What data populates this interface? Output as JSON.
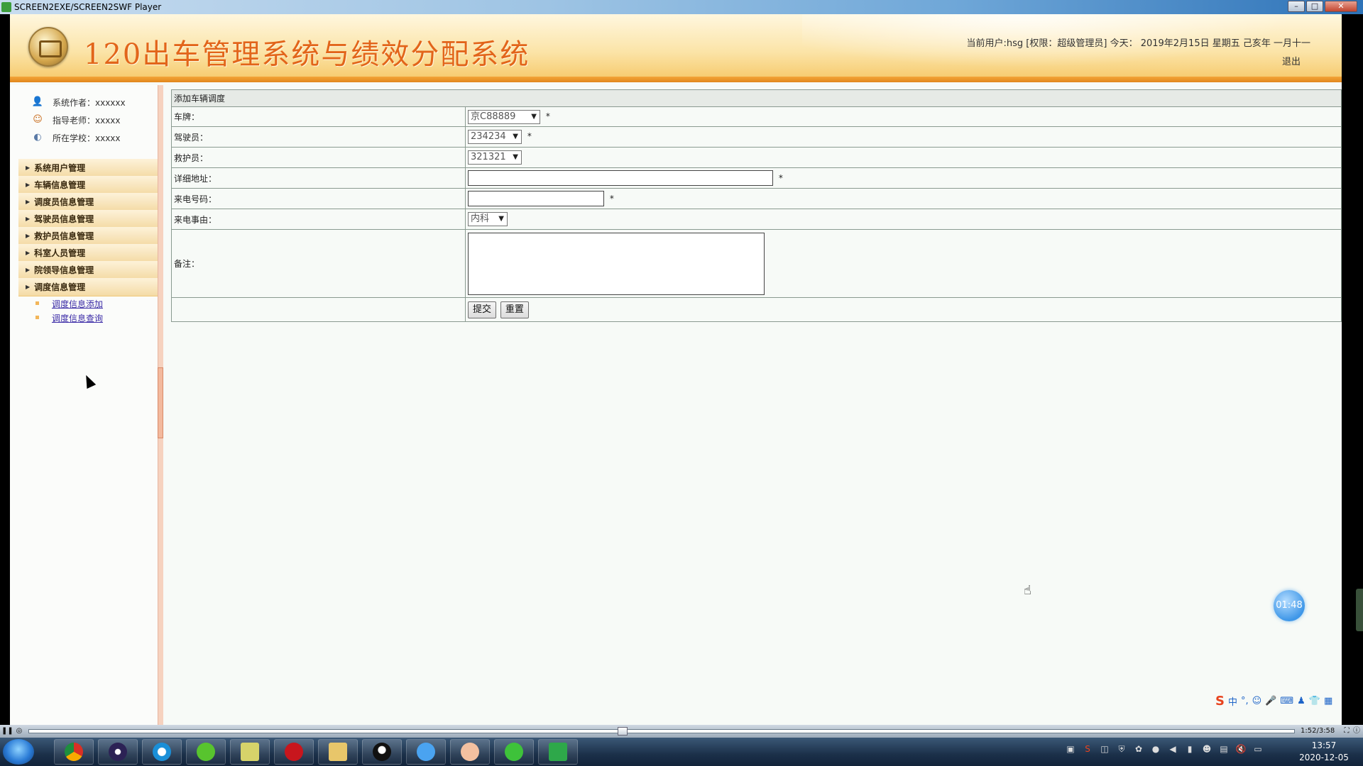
{
  "player": {
    "title": "SCREEN2EXE/SCREEN2SWF Player",
    "seek_time": "1:52/3:58"
  },
  "header": {
    "title": "120出车管理系统与绩效分配系统",
    "user_info": "当前用户:hsg [权限：超级管理员] 今天： 2019年2月15日 星期五 己亥年 一月十一",
    "logout": "退出"
  },
  "sidebar": {
    "info": [
      {
        "label": "系统作者：xxxxxx",
        "icon": "author-icon"
      },
      {
        "label": "指导老师：xxxxx",
        "icon": "teacher-icon"
      },
      {
        "label": "所在学校：xxxxx",
        "icon": "school-icon"
      }
    ],
    "menu": [
      "系统用户管理",
      "车辆信息管理",
      "调度员信息管理",
      "驾驶员信息管理",
      "救护员信息管理",
      "科室人员管理",
      "院领导信息管理",
      "调度信息管理"
    ],
    "submenu": [
      "调度信息添加",
      "调度信息查询"
    ]
  },
  "form": {
    "caption": "添加车辆调度",
    "fields": {
      "plate": {
        "label": "车牌：",
        "value": "京C88889"
      },
      "driver": {
        "label": "驾驶员：",
        "value": "234234"
      },
      "rescuer": {
        "label": "救护员：",
        "value": "321321"
      },
      "address": {
        "label": "详细地址：",
        "value": ""
      },
      "phone": {
        "label": "来电号码：",
        "value": ""
      },
      "reason": {
        "label": "来电事由：",
        "value": "内科"
      },
      "remark": {
        "label": "备注：",
        "value": ""
      }
    },
    "required_mark": "*",
    "submit": "提交",
    "reset": "重置"
  },
  "overlay": {
    "timer": "01:48",
    "ime": [
      "中",
      "°,",
      "☺",
      "🎤",
      "⌨",
      "♟",
      "👕",
      "▦"
    ]
  },
  "taskbar": {
    "time": "13:57",
    "date": "2020-12-05"
  },
  "colors": {
    "title_orange": "#e2651a",
    "header_bar": "#f3a53a",
    "menu_bg": "#f4dba6",
    "link": "#3a2aa6"
  }
}
